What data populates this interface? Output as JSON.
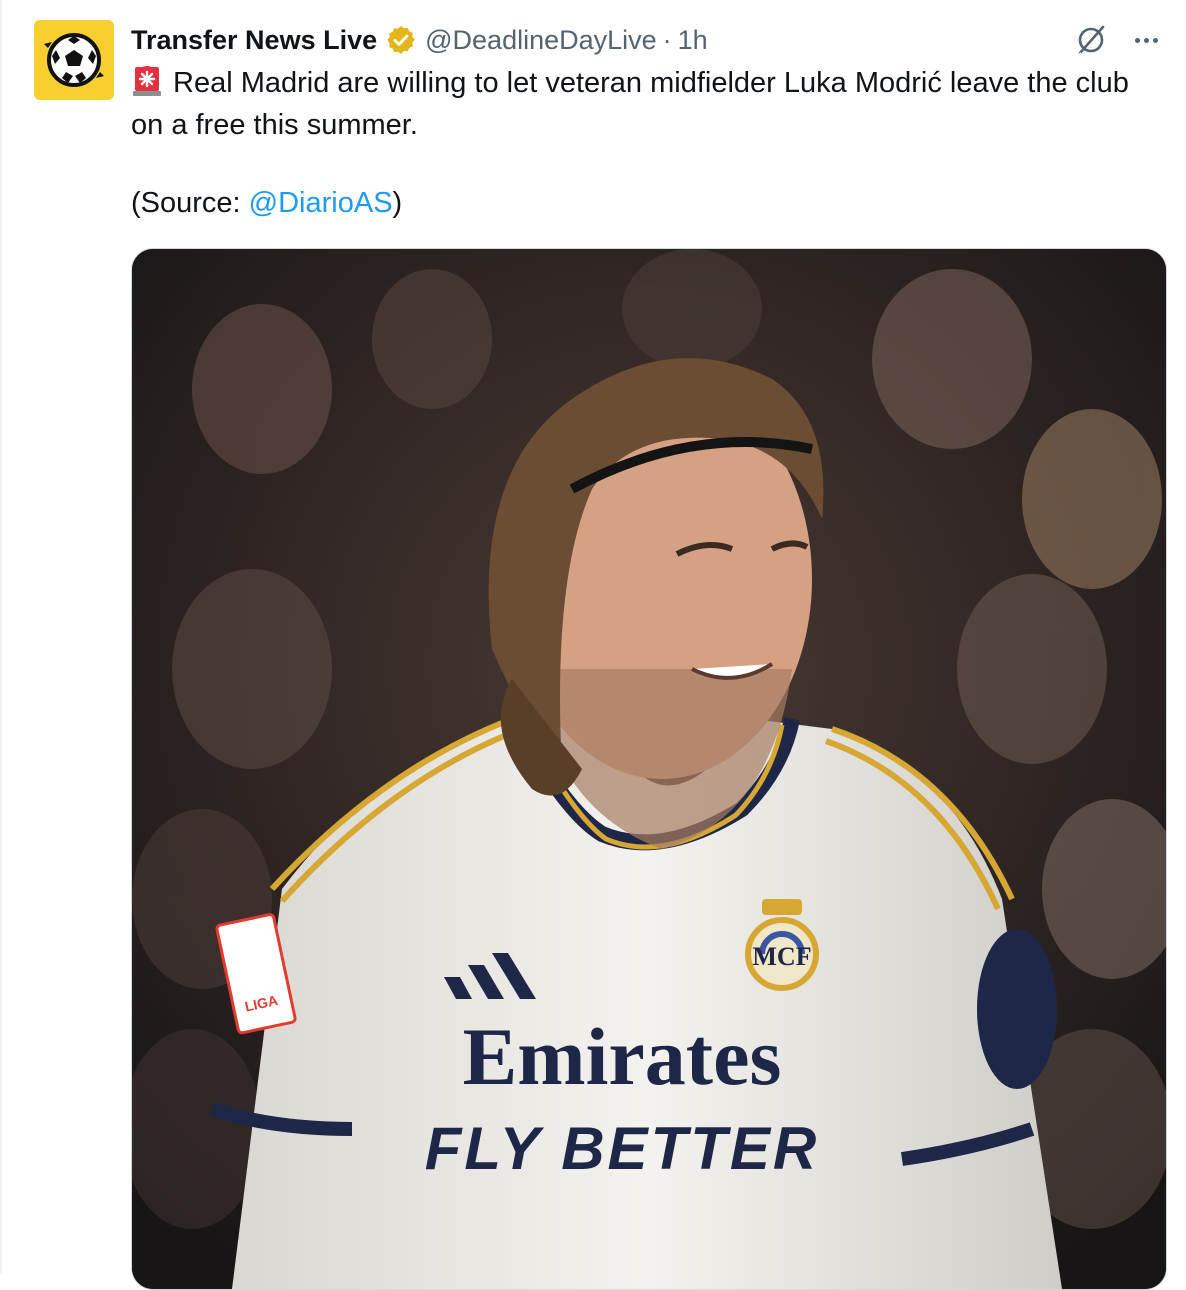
{
  "tweet": {
    "display_name": "Transfer News Live",
    "handle": "@DeadlineDayLive",
    "separator": "·",
    "time": "1h",
    "text": "Real Madrid are willing to let veteran midfielder Luka Modrić leave the club on a free this summer.",
    "source_prefix": "(Source: ",
    "source_mention": "@DiarioAS",
    "source_suffix": ")"
  },
  "media": {
    "shirt_sponsor_line1": "Emirates",
    "shirt_sponsor_line2": "FLY BETTER",
    "sleeve_patch": "LIGA"
  },
  "colors": {
    "avatar_bg": "#f9cf2f",
    "verified_badge": "#e2b719",
    "link": "#1d9bf0",
    "secondary_text": "#536471"
  },
  "icons": {
    "avatar": "soccer-ball-icon",
    "verified": "verified-badge-icon",
    "emoji": "police-siren-icon",
    "grok": "grok-icon",
    "more": "more-options-icon"
  }
}
